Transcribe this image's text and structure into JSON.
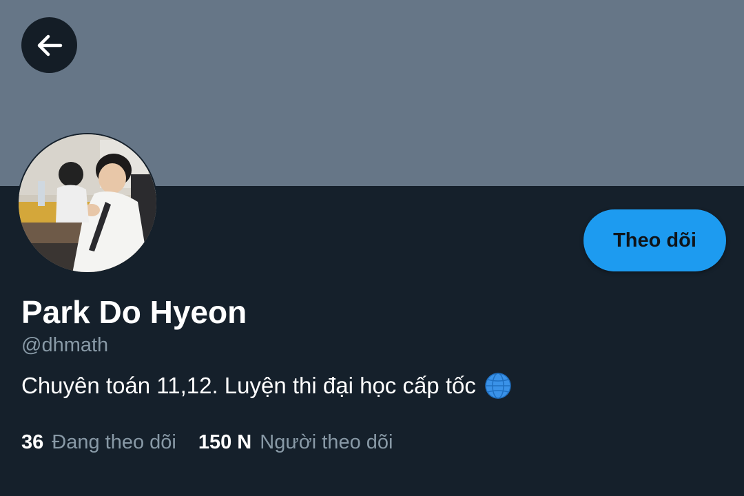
{
  "header": {
    "back_icon": "arrow-left-icon",
    "banner_color": "#667687"
  },
  "profile": {
    "display_name": "Park Do Hyeon",
    "handle": "@dhmath",
    "bio": "Chuyên toán 11,12. Luyện thi đại học cấp tốc",
    "bio_icon": "globe-icon"
  },
  "actions": {
    "follow_label": "Theo dõi",
    "accent_color": "#1d9bf0"
  },
  "stats": {
    "following_count": "36",
    "following_label": "Đang theo dõi",
    "followers_count": "150 N",
    "followers_label": "Người theo dõi"
  },
  "colors": {
    "background": "#15202b",
    "secondary_text": "#8899a6"
  }
}
